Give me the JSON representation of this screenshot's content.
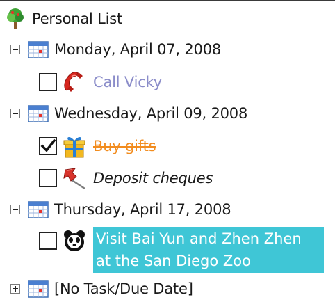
{
  "tree": {
    "root_label": "Personal List",
    "groups": [
      {
        "date": "Monday, April 07, 2008",
        "expanded": true,
        "tasks": [
          {
            "label": "Call Vicky",
            "checked": false,
            "icon": "phone-icon"
          }
        ]
      },
      {
        "date": "Wednesday, April 09, 2008",
        "expanded": true,
        "tasks": [
          {
            "label": "Buy gifts",
            "checked": true,
            "icon": "gift-icon"
          },
          {
            "label": "Deposit cheques",
            "checked": false,
            "icon": "pushpin-icon"
          }
        ]
      },
      {
        "date": "Thursday, April 17, 2008",
        "expanded": true,
        "tasks": [
          {
            "label": "Visit Bai Yun and Zhen Zhen at the San Diego Zoo",
            "checked": false,
            "icon": "panda-icon",
            "selected": true
          }
        ]
      },
      {
        "date": "[No Task/Due Date]",
        "expanded": false,
        "tasks": []
      }
    ]
  },
  "colors": {
    "selection": "#3fc6d6",
    "completed_text": "#f28c1e",
    "link_text": "#8a8cc9"
  }
}
